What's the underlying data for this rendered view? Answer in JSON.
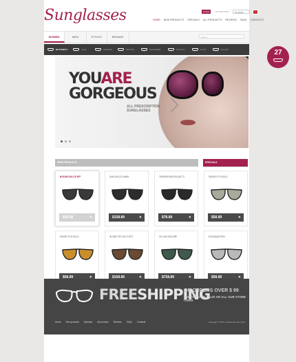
{
  "header": {
    "logo": {
      "first": "Sun",
      "rest": "glasses"
    },
    "login_label": "LOGIN",
    "account_label": "MY ACCOUNT",
    "currency_label": "US Dollar",
    "nav": [
      {
        "label": "HOME",
        "active": true
      },
      {
        "label": "NEW PRODUCTS",
        "active": false
      },
      {
        "label": "SPECIALS",
        "active": false
      },
      {
        "label": "ALL PRODUCTS",
        "active": false
      },
      {
        "label": "REVIEWS",
        "active": false
      },
      {
        "label": "FAQS",
        "active": false
      },
      {
        "label": "CONTACTS",
        "active": false
      }
    ]
  },
  "categories": [
    {
      "label": "WOMEN",
      "active": true
    },
    {
      "label": "MEN",
      "active": false
    },
    {
      "label": "STYLES",
      "active": false
    },
    {
      "label": "BRANDS",
      "active": false
    }
  ],
  "search": {
    "placeholder": "Search"
  },
  "styles": [
    {
      "label": "BUTTERFLY",
      "active": true
    },
    {
      "label": "OVAL",
      "active": false
    },
    {
      "label": "RIMLESS",
      "active": false
    },
    {
      "label": "SPORTS",
      "active": false
    },
    {
      "label": "WAYFARER",
      "active": false
    },
    {
      "label": "CAT EYE",
      "active": false
    },
    {
      "label": "PILOT",
      "active": false
    },
    {
      "label": "ROUND",
      "active": false
    }
  ],
  "badge": {
    "number": "27"
  },
  "hero": {
    "line1_a": "YOU",
    "line1_b": "ARE",
    "line2": "GORGEOUS",
    "subtitle_1": "ALL PRESCRIPTION",
    "subtitle_2": "SUNGLASSES"
  },
  "sections": {
    "new": "NEW PRODUCTS",
    "specials": "SPECIALS"
  },
  "products": [
    {
      "name": "BYSOM DOLCE 5FF",
      "price": "$58.89",
      "highlight": true,
      "lens": "#3a3a3a"
    },
    {
      "name": "SUN DOLCE 4AW9",
      "price": "$158.89",
      "highlight": false,
      "lens": "#2d2d2d"
    },
    {
      "name": "TEMPOR NECROLIAT 2T",
      "price": "$78.89",
      "highlight": false,
      "lens": "#2a2a2a"
    },
    {
      "name": "FAVOR 4T 8 SOLO",
      "price": "$58.89",
      "highlight": false,
      "lens": "#a8ab9a"
    },
    {
      "name": "FAVOR 4T 8 DOLO",
      "price": "$58.89",
      "highlight": false,
      "lens": "#c98f2c"
    },
    {
      "name": "IN 9QE STE VELIT EST",
      "price": "$158.89",
      "highlight": false,
      "lens": "#6b4a32"
    },
    {
      "name": "CILLUM DOLORE",
      "price": "$758.89",
      "highlight": false,
      "lens": "#3f5a4a"
    },
    {
      "name": "EXCEQUM PEN",
      "price": "$58.89",
      "highlight": false,
      "lens": "#b9b9b9"
    }
  ],
  "banner": {
    "free": "FREE",
    "shipping": "SHIPPING",
    "orders": "ON ORDERS OVER $ 99",
    "note": "THIS OFFER IS VALID ON ALL OUR STORE ITEMS"
  },
  "footer": {
    "links": [
      "Home",
      "New products",
      "Specials",
      "All products",
      "Reviews",
      "FAQs",
      "Contacts"
    ],
    "copyright": "Copyright © 2011. Powered by Zen Cart"
  },
  "colors": {
    "accent": "#a3214f",
    "dark": "#3c3c3c"
  }
}
